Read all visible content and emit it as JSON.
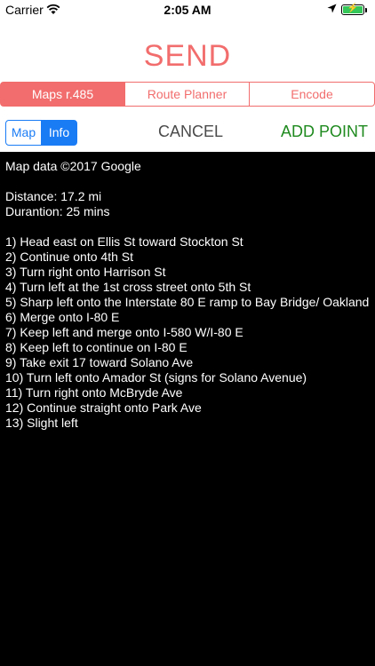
{
  "status_bar": {
    "carrier": "Carrier",
    "time": "2:05 AM",
    "icons": [
      "wifi-icon",
      "location-arrow-icon",
      "battery-charging-icon"
    ]
  },
  "header": {
    "title": "SEND"
  },
  "segments": [
    {
      "label": "Maps r.485",
      "active": true
    },
    {
      "label": "Route Planner",
      "active": false
    },
    {
      "label": "Encode",
      "active": false
    }
  ],
  "view_toggle": {
    "map_label": "Map",
    "info_label": "Info",
    "selected": "Info"
  },
  "actions": {
    "cancel_label": "CANCEL",
    "add_point_label": "ADD POINT"
  },
  "info": {
    "map_data": "Map data ©2017 Google",
    "distance": "Distance: 17.2 mi",
    "duration": "Durantion: 25 mins",
    "directions": [
      "1) Head east on Ellis St toward Stockton St",
      "2) Continue onto 4th St",
      "3) Turn right onto Harrison St",
      "4) Turn left at the 1st cross street onto 5th St",
      "5) Sharp left onto the Interstate 80 E ramp to Bay Bridge/ Oakland",
      "6) Merge onto I-80 E",
      "7) Keep left and merge onto I-580 W/I-80 E",
      "8) Keep left to continue on I-80 E",
      "9) Take exit 17 toward Solano Ave",
      "10) Turn left onto Amador St (signs for Solano Avenue)",
      "11) Turn right onto McBryde Ave",
      "12) Continue straight onto Park Ave",
      "13) Slight left"
    ]
  },
  "colors": {
    "accent": "#f26d6d",
    "toggle_blue": "#1a7cf5",
    "add_point_green": "#1f8a1f",
    "cancel_gray": "#4a4a4a",
    "content_bg": "#000000"
  }
}
